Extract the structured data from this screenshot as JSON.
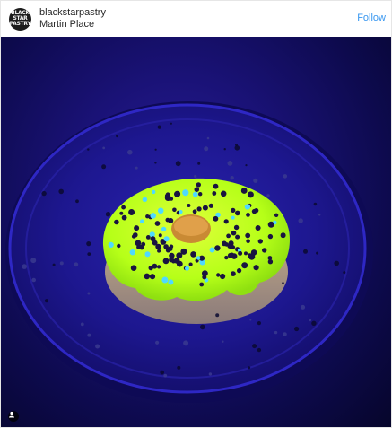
{
  "header": {
    "username": "blackstarpastry",
    "location": "Martin Place",
    "follow_label": "Follow"
  },
  "avatar": {
    "logo_lines": [
      "BLACK",
      "STAR",
      "PASTRY"
    ]
  },
  "icons": {
    "user_tag": "person-icon"
  },
  "colors": {
    "follow": "#3897f0",
    "text": "#262626",
    "glaze": "#b8ff1a",
    "plate": "#1b1585"
  }
}
